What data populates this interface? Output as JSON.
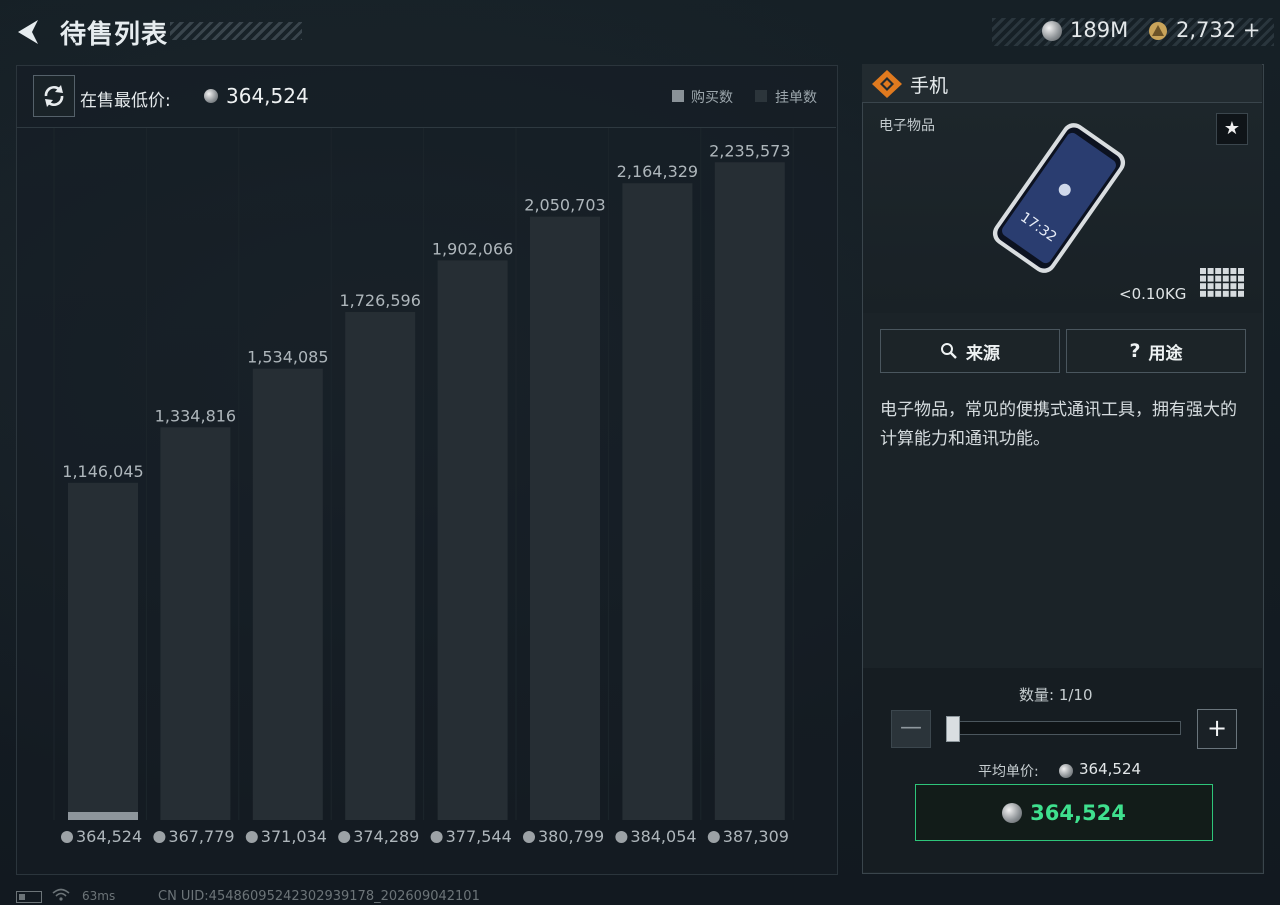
{
  "header": {
    "title": "待售列表",
    "currency_silver": "189M",
    "currency_gold": "2,732",
    "currency_gold_plus": "+"
  },
  "chart_header": {
    "lowest_price_label": "在售最低价:",
    "lowest_price_value": "364,524",
    "legend_buy": "购买数",
    "legend_list": "挂单数"
  },
  "chart_data": {
    "type": "bar",
    "categories": [
      "364,524",
      "367,779",
      "371,034",
      "374,289",
      "377,544",
      "380,799",
      "384,054",
      "387,309"
    ],
    "series": [
      {
        "name": "挂单数",
        "values": [
          1146045,
          1334816,
          1534085,
          1726596,
          1902066,
          2050703,
          2164329,
          2235573
        ]
      },
      {
        "name": "购买数",
        "values": [
          20000,
          0,
          0,
          0,
          0,
          0,
          0,
          0
        ]
      }
    ],
    "data_labels": [
      "1,146,045",
      "1,334,816",
      "1,534,085",
      "1,726,596",
      "1,902,066",
      "2,050,703",
      "2,164,329",
      "2,235,573"
    ],
    "ylim": [
      0,
      2460000
    ],
    "colors": {
      "listing": "#262e34",
      "buy": "#8e969c",
      "label": "#aeb6bb"
    }
  },
  "item": {
    "name": "手机",
    "category": "电子物品",
    "weight": "<0.10KG",
    "favorite_icon": "star-icon",
    "source_label": "来源",
    "usage_label": "用途",
    "description": "电子物品，常见的便携式通讯工具，拥有强大的计算能力和通讯功能。"
  },
  "purchase": {
    "quantity_label": "数量: 1/10",
    "quantity": 1,
    "quantity_max": 10,
    "avg_price_label": "平均单价:",
    "avg_price_value": "364,524",
    "buy_price": "364,524",
    "accent_color": "#3fe08e"
  },
  "status": {
    "ping": "63ms",
    "uid": "CN UID:45486095242302939178_202609042101"
  }
}
